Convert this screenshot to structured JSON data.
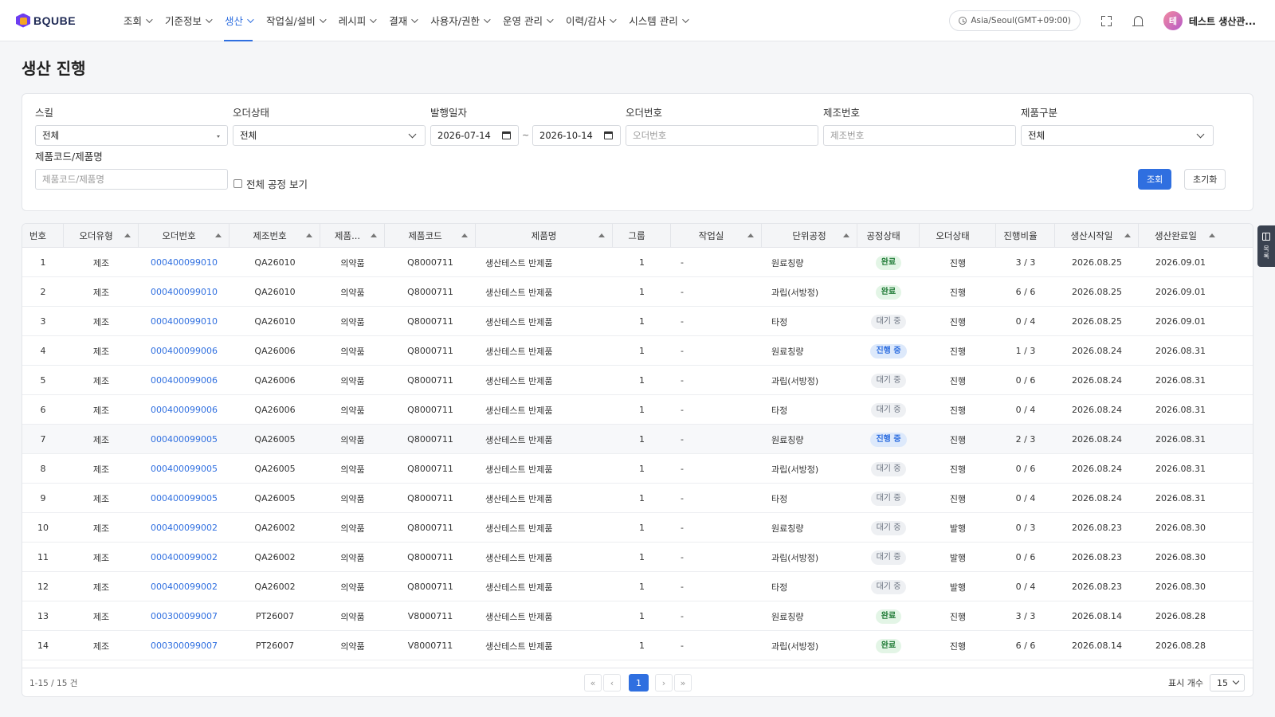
{
  "brand": {
    "name": "BQUBE"
  },
  "nav": {
    "items": [
      {
        "label": "조회"
      },
      {
        "label": "기준정보"
      },
      {
        "label": "생산"
      },
      {
        "label": "작업실/설비"
      },
      {
        "label": "레시피"
      },
      {
        "label": "결재"
      },
      {
        "label": "사용자/권한"
      },
      {
        "label": "운영 관리"
      },
      {
        "label": "이력/감사"
      },
      {
        "label": "시스템 관리"
      }
    ],
    "active_index": 2
  },
  "header": {
    "timezone": "Asia/Seoul(GMT+09:00)",
    "user_initial": "테",
    "user_name": "테스트 생산관..."
  },
  "page": {
    "title": "생산 진행"
  },
  "filters": {
    "skill": {
      "label": "스킬",
      "value": "전체"
    },
    "order_status": {
      "label": "오더상태",
      "value": "전체"
    },
    "issue_date": {
      "label": "발행일자",
      "from": "2026-07-14",
      "to": "2026-10-14",
      "sep": "~"
    },
    "order_no": {
      "label": "오더번호",
      "placeholder": "오더번호"
    },
    "mfg_no": {
      "label": "제조번호",
      "placeholder": "제조번호"
    },
    "product_type": {
      "label": "제품구분",
      "value": "전체"
    },
    "product_code": {
      "label": "제품코드/제품명",
      "placeholder": "제품코드/제품명"
    },
    "show_all_label": "전체 공정 보기",
    "search_label": "조회",
    "reset_label": "초기화"
  },
  "table": {
    "columns": [
      "번호",
      "오더유형",
      "오더번호",
      "제조번호",
      "제품...",
      "제품코드",
      "제품명",
      "그룹",
      "작업실",
      "단위공정",
      "공정상태",
      "오더상태",
      "진행비율",
      "생산시작일",
      "생산완료일"
    ],
    "rows": [
      {
        "no": "1",
        "type": "제조",
        "order": "000400099010",
        "mfg": "QA26010",
        "cat": "의약품",
        "code": "Q8000711",
        "name": "생산테스트 반제품",
        "group": "1",
        "room": "-",
        "process": "원료칭량",
        "pstatus": "완료",
        "pkind": "done",
        "ostatus": "진행",
        "ratio": "3 / 3",
        "start": "2026.08.25",
        "end": "2026.09.01"
      },
      {
        "no": "2",
        "type": "제조",
        "order": "000400099010",
        "mfg": "QA26010",
        "cat": "의약품",
        "code": "Q8000711",
        "name": "생산테스트 반제품",
        "group": "1",
        "room": "-",
        "process": "과립(서방정)",
        "pstatus": "완료",
        "pkind": "done",
        "ostatus": "진행",
        "ratio": "6 / 6",
        "start": "2026.08.25",
        "end": "2026.09.01"
      },
      {
        "no": "3",
        "type": "제조",
        "order": "000400099010",
        "mfg": "QA26010",
        "cat": "의약품",
        "code": "Q8000711",
        "name": "생산테스트 반제품",
        "group": "1",
        "room": "-",
        "process": "타정",
        "pstatus": "대기 중",
        "pkind": "wait",
        "ostatus": "진행",
        "ratio": "0 / 4",
        "start": "2026.08.25",
        "end": "2026.09.01"
      },
      {
        "no": "4",
        "type": "제조",
        "order": "000400099006",
        "mfg": "QA26006",
        "cat": "의약품",
        "code": "Q8000711",
        "name": "생산테스트 반제품",
        "group": "1",
        "room": "-",
        "process": "원료칭량",
        "pstatus": "진행 중",
        "pkind": "prog",
        "ostatus": "진행",
        "ratio": "1 / 3",
        "start": "2026.08.24",
        "end": "2026.08.31"
      },
      {
        "no": "5",
        "type": "제조",
        "order": "000400099006",
        "mfg": "QA26006",
        "cat": "의약품",
        "code": "Q8000711",
        "name": "생산테스트 반제품",
        "group": "1",
        "room": "-",
        "process": "과립(서방정)",
        "pstatus": "대기 중",
        "pkind": "wait",
        "ostatus": "진행",
        "ratio": "0 / 6",
        "start": "2026.08.24",
        "end": "2026.08.31"
      },
      {
        "no": "6",
        "type": "제조",
        "order": "000400099006",
        "mfg": "QA26006",
        "cat": "의약품",
        "code": "Q8000711",
        "name": "생산테스트 반제품",
        "group": "1",
        "room": "-",
        "process": "타정",
        "pstatus": "대기 중",
        "pkind": "wait",
        "ostatus": "진행",
        "ratio": "0 / 4",
        "start": "2026.08.24",
        "end": "2026.08.31"
      },
      {
        "no": "7",
        "type": "제조",
        "order": "000400099005",
        "mfg": "QA26005",
        "cat": "의약품",
        "code": "Q8000711",
        "name": "생산테스트 반제품",
        "group": "1",
        "room": "-",
        "process": "원료칭량",
        "pstatus": "진행 중",
        "pkind": "prog",
        "ostatus": "진행",
        "ratio": "2 / 3",
        "start": "2026.08.24",
        "end": "2026.08.31",
        "highlight": true
      },
      {
        "no": "8",
        "type": "제조",
        "order": "000400099005",
        "mfg": "QA26005",
        "cat": "의약품",
        "code": "Q8000711",
        "name": "생산테스트 반제품",
        "group": "1",
        "room": "-",
        "process": "과립(서방정)",
        "pstatus": "대기 중",
        "pkind": "wait",
        "ostatus": "진행",
        "ratio": "0 / 6",
        "start": "2026.08.24",
        "end": "2026.08.31"
      },
      {
        "no": "9",
        "type": "제조",
        "order": "000400099005",
        "mfg": "QA26005",
        "cat": "의약품",
        "code": "Q8000711",
        "name": "생산테스트 반제품",
        "group": "1",
        "room": "-",
        "process": "타정",
        "pstatus": "대기 중",
        "pkind": "wait",
        "ostatus": "진행",
        "ratio": "0 / 4",
        "start": "2026.08.24",
        "end": "2026.08.31"
      },
      {
        "no": "10",
        "type": "제조",
        "order": "000400099002",
        "mfg": "QA26002",
        "cat": "의약품",
        "code": "Q8000711",
        "name": "생산테스트 반제품",
        "group": "1",
        "room": "-",
        "process": "원료칭량",
        "pstatus": "대기 중",
        "pkind": "wait",
        "ostatus": "발행",
        "ratio": "0 / 3",
        "start": "2026.08.23",
        "end": "2026.08.30"
      },
      {
        "no": "11",
        "type": "제조",
        "order": "000400099002",
        "mfg": "QA26002",
        "cat": "의약품",
        "code": "Q8000711",
        "name": "생산테스트 반제품",
        "group": "1",
        "room": "-",
        "process": "과립(서방정)",
        "pstatus": "대기 중",
        "pkind": "wait",
        "ostatus": "발행",
        "ratio": "0 / 6",
        "start": "2026.08.23",
        "end": "2026.08.30"
      },
      {
        "no": "12",
        "type": "제조",
        "order": "000400099002",
        "mfg": "QA26002",
        "cat": "의약품",
        "code": "Q8000711",
        "name": "생산테스트 반제품",
        "group": "1",
        "room": "-",
        "process": "타정",
        "pstatus": "대기 중",
        "pkind": "wait",
        "ostatus": "발행",
        "ratio": "0 / 4",
        "start": "2026.08.23",
        "end": "2026.08.30"
      },
      {
        "no": "13",
        "type": "제조",
        "order": "000300099007",
        "mfg": "PT26007",
        "cat": "의약품",
        "code": "V8000711",
        "name": "생산테스트 반제품",
        "group": "1",
        "room": "-",
        "process": "원료칭량",
        "pstatus": "완료",
        "pkind": "done",
        "ostatus": "진행",
        "ratio": "3 / 3",
        "start": "2026.08.14",
        "end": "2026.08.28"
      },
      {
        "no": "14",
        "type": "제조",
        "order": "000300099007",
        "mfg": "PT26007",
        "cat": "의약품",
        "code": "V8000711",
        "name": "생산테스트 반제품",
        "group": "1",
        "room": "-",
        "process": "과립(서방정)",
        "pstatus": "완료",
        "pkind": "done",
        "ostatus": "진행",
        "ratio": "6 / 6",
        "start": "2026.08.14",
        "end": "2026.08.28"
      }
    ]
  },
  "footer": {
    "total": "1-15 / 15 건",
    "pager": {
      "first": "«",
      "prev": "‹",
      "current": "1",
      "next": "›",
      "last": "»"
    },
    "page_size_label": "표시 개수",
    "page_size": "15"
  },
  "side_tab": {
    "label": "목록",
    "icon": "panel-icon"
  }
}
